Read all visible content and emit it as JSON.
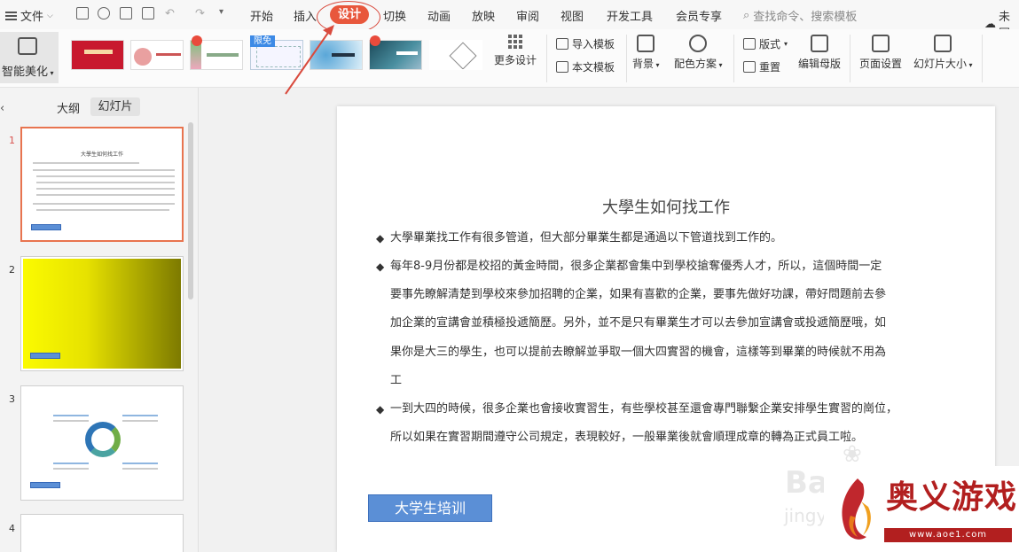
{
  "menu": {
    "file_label": "文件",
    "tabs": [
      "开始",
      "插入",
      "设计",
      "切换",
      "动画",
      "放映",
      "审阅",
      "视图",
      "开发工具",
      "会员专享"
    ],
    "active_tab": "设计",
    "search_placeholder": "查找命令、搜索模板",
    "cloud_label": "未同"
  },
  "toolbar": {
    "smart_beautify": "智能美化",
    "free_badge": "限免",
    "more_design": "更多设计",
    "import_template": "导入模板",
    "text_template": "本文模板",
    "background": "背景",
    "color_scheme": "配色方案",
    "layout": "版式",
    "reset": "重置",
    "edit_master": "编辑母版",
    "page_setup": "页面设置",
    "slide_size": "幻灯片大小"
  },
  "left_panel": {
    "outline_tab": "大纲",
    "slides_tab": "幻灯片",
    "slide_numbers": [
      "1",
      "2",
      "3",
      "4"
    ]
  },
  "slide": {
    "title": "大學生如何找工作",
    "paragraphs": [
      [
        "大學畢業找工作有很多管道，但大部分畢業生都是通過以下管道找到工作的。"
      ],
      [
        "每年8-9月份都是校招的黃金時間，很多企業都會集中到學校搶奪優秀人才，所以，這個時間一定",
        "要事先瞭解清楚到學校來參加招聘的企業，如果有喜歡的企業，要事先做好功課，帶好問題前去參",
        "加企業的宣講會並積極投遞簡歷。另外，並不是只有畢業生才可以去參加宣講會或投遞簡歷哦，如",
        "果你是大三的學生，也可以提前去瞭解並爭取一個大四實習的機會，這樣等到畢業的時候就不用為",
        "工"
      ],
      [
        "一到大四的時候，很多企業也會接收實習生，有些學校甚至還會專門聯繫企業安排學生實習的崗位，",
        "所以如果在實習期間遵守公司規定，表現較好，一般畢業後就會順理成章的轉為正式員工啦。"
      ]
    ],
    "button_label": "大学生培训"
  },
  "thumbnail_1": {
    "title": "大學生如何找工作",
    "button": "大学生培训"
  },
  "watermark": {
    "baidu": "Bai",
    "jingyan": "jingya"
  },
  "logo": {
    "text": "奥义游戏网",
    "url": "www.aoe1.com"
  },
  "colors": {
    "accent": "#e8573c",
    "slide_button": "#5b8fd6",
    "logo_red": "#b21f1f"
  }
}
